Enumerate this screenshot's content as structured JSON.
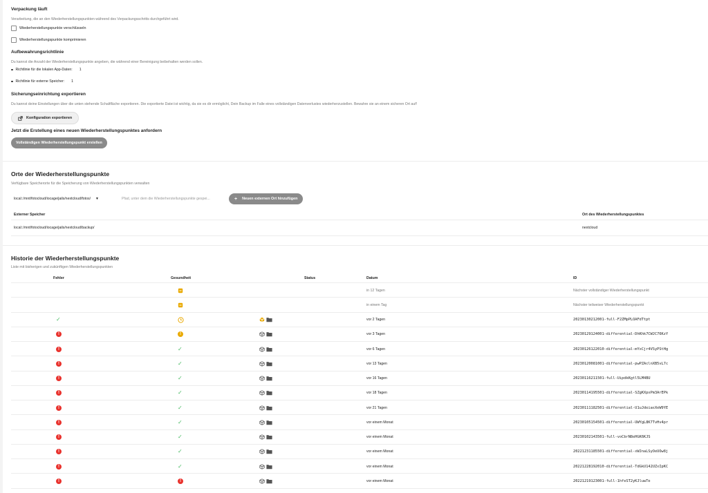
{
  "packaging": {
    "title": "Verpackung läuft",
    "desc": "Verarbeitung, die an den Wiederherstellungspunkten während des Verpackungsschritts durchgeführt wird.",
    "encrypt_label": "Wiederherstellungspunkte verschlüsseln",
    "compress_label": "Wiederherstellungspunkte komprimieren"
  },
  "retention": {
    "title": "Aufbewahrungsrichtlinie",
    "desc": "Du kannst die Anzahl der Wiederherstellungspunkte angeben, die während einer Bereinigung beibehalten werden sollen.",
    "local_label": "Richtlinie für die lokalen App-Daten:",
    "local_value": "1",
    "external_label": "Richtlinie für externe Speicher:",
    "external_value": "1"
  },
  "export": {
    "title": "Sicherungseinrichtung exportieren",
    "desc": "Du kannst deine Einstellungen über die unten stehende Schaltfläche exportieren. Die exportierte Datei ist wichtig, da sie es dir ermöglicht, Dein Backup im Falle eines vollständigen Datenverlustes wiederherzustellen. Bewahre sie an einem sicheren Ort auf!",
    "button_label": "Konfiguration exportieren"
  },
  "request": {
    "title": "Jetzt die Erstellung eines neuen Wiederherstellungspunktes anfordern",
    "button_label": "Vollständigen Wiederherstellungspunkt erstellen"
  },
  "locations": {
    "title": "Orte der Wiederherstellungspunkte",
    "desc": "Verfügbare Speicherorte für die Speicherung von Wiederherstellungspunkten verwalten",
    "select_value": "local::/mnt/fotocloud/iocage/jails/nextcloud/fotos/",
    "path_placeholder": "Pfad, unter dem die Wiederherstellungspunkte gespei...",
    "add_button_label": "Neuen externen Ort hinzufügen",
    "col_storage": "Externer Speicher",
    "col_location": "Ort des Wiederherstellungspunktes",
    "rows": [
      {
        "storage": "local::/mnt/fotocloud/iocage/jails/nextcloud/backup/",
        "location": "nextcloud"
      }
    ]
  },
  "history": {
    "title": "Historie der Wiederherstellungspunkte",
    "desc": "Liste mit bisherigen und zukünftigen Wiederherstellungspunkten",
    "col_error": "Fehler",
    "col_health": "Gesundheit",
    "col_status": "Status",
    "col_date": "Datum",
    "col_id": "ID",
    "rows": [
      {
        "error": "",
        "health": "pending",
        "status": "",
        "date": "in 12 Tagen",
        "id": "Nächster vollständiger Wiederherstellungspunkt",
        "future": true
      },
      {
        "error": "",
        "health": "pending",
        "status": "",
        "date": "in einem Tag",
        "id": "Nächster teilweiser Wiederherstellungspunkt",
        "future": true
      },
      {
        "error": "ok",
        "health": "clock",
        "status": "packing",
        "date": "vor 2 Tagen",
        "id": "20230130212001-full-F2ZMpPLOAFdTtpt",
        "future": false
      },
      {
        "error": "error",
        "health": "warn",
        "status": "stored",
        "date": "vor 3 Tagen",
        "id": "20230129124001-differential-DhKhk7CWJC76KzY",
        "future": false
      },
      {
        "error": "error",
        "health": "ok",
        "status": "stored",
        "date": "vor 6 Tagen",
        "id": "20230126122010-differential-mYxCjr4VSyPStHg",
        "future": false
      },
      {
        "error": "error",
        "health": "ok",
        "status": "stored",
        "date": "vor 13 Tagen",
        "id": "20230120081001-differential-pwPZAclnXB5vL7c",
        "future": false
      },
      {
        "error": "error",
        "health": "ok",
        "status": "stored",
        "date": "vor 16 Tagen",
        "id": "20230116211501-full-UipdkKgtl5LM4BU",
        "future": false
      },
      {
        "error": "error",
        "health": "ok",
        "status": "stored",
        "date": "vor 18 Tagen",
        "id": "20230114195501-differential-SZgKXpxPm3ArEPk",
        "future": false
      },
      {
        "error": "error",
        "health": "ok",
        "status": "stored",
        "date": "vor 21 Tagen",
        "id": "20230111182501-differential-U1uJdeiasXeW9YE",
        "future": false
      },
      {
        "error": "error",
        "health": "ok",
        "status": "stored",
        "date": "vor einem Monat",
        "id": "20230105154501-differential-UWYgL8K7TvHv4pr",
        "future": false
      },
      {
        "error": "error",
        "health": "ok",
        "status": "stored",
        "date": "vor einem Monat",
        "id": "20230102143501-full-voCbrN8eHGK6KJS",
        "future": false
      },
      {
        "error": "error",
        "health": "ok",
        "status": "stored",
        "date": "vor einem Monat",
        "id": "20221231185501-differential-xWJnaLSyOeUOw8j",
        "future": false
      },
      {
        "error": "error",
        "health": "ok",
        "status": "stored",
        "date": "vor einem Monat",
        "id": "20221228192010-differential-TdGkU142UZxIpKC",
        "future": false
      },
      {
        "error": "error",
        "health": "error",
        "status": "stored",
        "date": "vor einem Monat",
        "id": "20221219123001-full-1hfeST2yKJluwTe",
        "future": false
      }
    ]
  }
}
